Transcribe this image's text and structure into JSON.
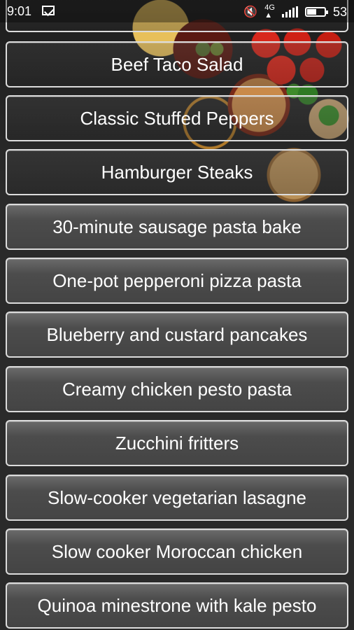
{
  "status_bar": {
    "time": "9:01",
    "battery_level": "53",
    "battery_percent": 0.53,
    "icons": [
      "mail-icon",
      "mute-icon",
      "signal-4g-icon",
      "signal-bars-icon",
      "battery-icon"
    ]
  },
  "recipes": [
    {
      "label": ""
    },
    {
      "label": "Beef Taco Salad"
    },
    {
      "label": "Classic Stuffed Peppers"
    },
    {
      "label": "Hamburger Steaks"
    },
    {
      "label": "30-minute sausage pasta bake"
    },
    {
      "label": "One-pot pepperoni pizza pasta"
    },
    {
      "label": "Blueberry and custard pancakes"
    },
    {
      "label": "Creamy chicken pesto pasta"
    },
    {
      "label": "Zucchini fritters"
    },
    {
      "label": "Slow-cooker vegetarian  lasagne"
    },
    {
      "label": "Slow cooker Moroccan chicken"
    },
    {
      "label": "Quinoa minestrone with kale pesto"
    }
  ]
}
